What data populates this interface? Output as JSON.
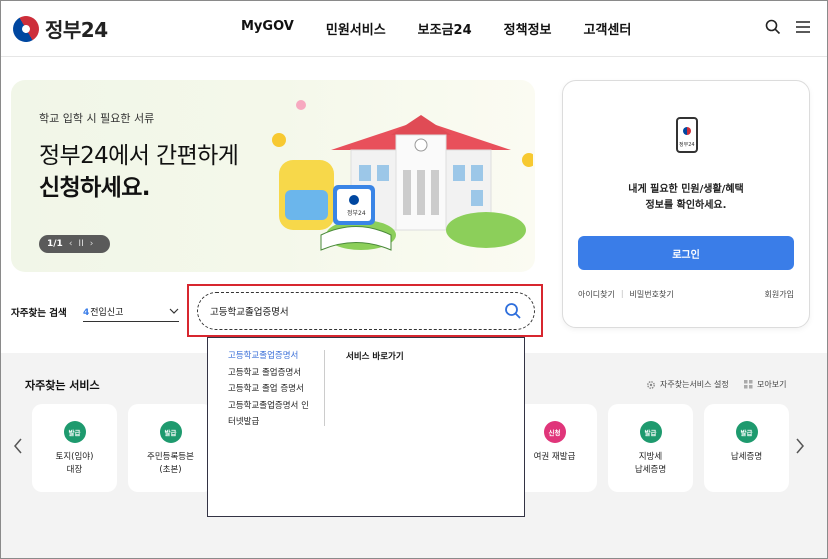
{
  "header": {
    "logo_text": "정부24",
    "nav": [
      "MyGOV",
      "민원서비스",
      "보조금24",
      "정책정보",
      "고객센터"
    ]
  },
  "banner": {
    "subtitle": "학교 입학 시 필요한 서류",
    "title_line1": "정부24에서 간편하게",
    "title_line2": "신청하세요.",
    "page_indicator": "1/1",
    "illustration_tablet_text": "정부24"
  },
  "login": {
    "phone_label": "정부24",
    "message_line1": "내게 필요한 민원/생활/혜택",
    "message_line2": "정보를 확인하세요.",
    "button": "로그인",
    "find_id": "아이디찾기",
    "find_pw": "비밀번호찾기",
    "join": "회원가입"
  },
  "quick_search": {
    "label": "자주찾는 검색",
    "selected_num": "4",
    "selected_text": "전입신고",
    "input_value": "고등학교졸업증명서"
  },
  "autocomplete": {
    "items": [
      "고등학교졸업증명서",
      "고등학교 졸업증명서",
      "고등학교 졸업 증명서",
      "고등학교졸업증명서 인",
      "터넷발급"
    ],
    "right_title": "서비스 바로가기"
  },
  "services": {
    "title": "자주찾는 서비스",
    "setting_label": "자주찾는서비스 설정",
    "more_label": "모아보기",
    "cards": [
      {
        "badge": "발급",
        "badge_color": "#1e9a6e",
        "name": "토지(임야)\n대장"
      },
      {
        "badge": "발급",
        "badge_color": "#1e9a6e",
        "name": "주민등록등본\n(초본)"
      },
      {
        "badge": "신청",
        "badge_color": "#e0357a",
        "name": "여권 재발급"
      },
      {
        "badge": "발급",
        "badge_color": "#1e9a6e",
        "name": "지방세\n납세증명"
      },
      {
        "badge": "발급",
        "badge_color": "#1e9a6e",
        "name": "납세증명"
      }
    ]
  }
}
